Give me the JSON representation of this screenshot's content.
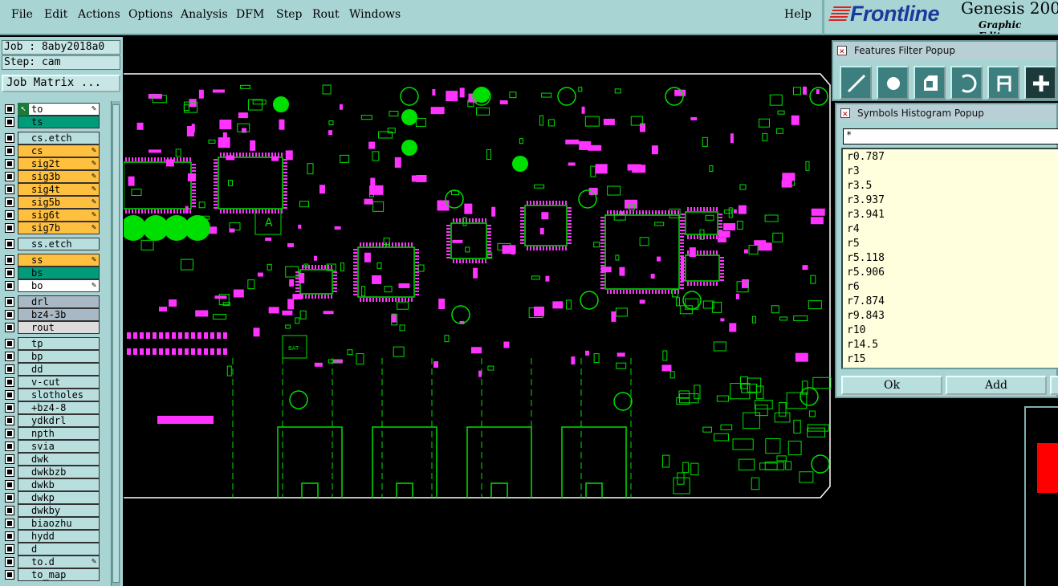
{
  "menu": [
    "File",
    "Edit",
    "Actions",
    "Options",
    "Analysis",
    "DFM",
    "Step",
    "Rout",
    "Windows"
  ],
  "help_label": "Help",
  "brand": {
    "logo": "Frontline",
    "name": "Genesis 200",
    "subtitle": "Graphic Editor"
  },
  "job": "Job : 8aby2018a0",
  "step": "Step: cam",
  "job_matrix_label": "Job Matrix ...",
  "layers": [
    {
      "name": "to",
      "color": "#ffffff",
      "edit": true,
      "active": true
    },
    {
      "name": "ts",
      "color": "#009c7a",
      "edit": false
    },
    {
      "name": "cs.etch",
      "color": "#b8dede",
      "edit": false
    },
    {
      "name": "cs",
      "color": "#ffc040",
      "edit": true
    },
    {
      "name": "sig2t",
      "color": "#ffc040",
      "edit": true
    },
    {
      "name": "sig3b",
      "color": "#ffc040",
      "edit": true
    },
    {
      "name": "sig4t",
      "color": "#ffc040",
      "edit": true
    },
    {
      "name": "sig5b",
      "color": "#ffc040",
      "edit": true
    },
    {
      "name": "sig6t",
      "color": "#ffc040",
      "edit": true
    },
    {
      "name": "sig7b",
      "color": "#ffc040",
      "edit": true
    },
    {
      "name": "ss.etch",
      "color": "#b8dede",
      "edit": false
    },
    {
      "name": "ss",
      "color": "#ffc040",
      "edit": true
    },
    {
      "name": "bs",
      "color": "#009c7a",
      "edit": false
    },
    {
      "name": "bo",
      "color": "#ffffff",
      "edit": true
    },
    {
      "name": "drl",
      "color": "#a8b8c4",
      "edit": false
    },
    {
      "name": "bz4-3b",
      "color": "#a8b8c4",
      "edit": false
    },
    {
      "name": "rout",
      "color": "#dcdcdc",
      "edit": false
    },
    {
      "name": "tp",
      "color": "#b8dede",
      "edit": false
    },
    {
      "name": "bp",
      "color": "#b8dede",
      "edit": false
    },
    {
      "name": "dd",
      "color": "#b8dede",
      "edit": false
    },
    {
      "name": "v-cut",
      "color": "#b8dede",
      "edit": false
    },
    {
      "name": "slotholes",
      "color": "#b8dede",
      "edit": false
    },
    {
      "name": "+bz4-8",
      "color": "#b8dede",
      "edit": false
    },
    {
      "name": "ydkdrl",
      "color": "#b8dede",
      "edit": false
    },
    {
      "name": "npth",
      "color": "#b8dede",
      "edit": false
    },
    {
      "name": "svia",
      "color": "#b8dede",
      "edit": false
    },
    {
      "name": "dwk",
      "color": "#b8dede",
      "edit": false
    },
    {
      "name": "dwkbzb",
      "color": "#b8dede",
      "edit": false
    },
    {
      "name": "dwkb",
      "color": "#b8dede",
      "edit": false
    },
    {
      "name": "dwkp",
      "color": "#b8dede",
      "edit": false
    },
    {
      "name": "dwkby",
      "color": "#b8dede",
      "edit": false
    },
    {
      "name": "biaozhu",
      "color": "#b8dede",
      "edit": false
    },
    {
      "name": "hydd",
      "color": "#b8dede",
      "edit": false
    },
    {
      "name": "d",
      "color": "#b8dede",
      "edit": false
    },
    {
      "name": "to.d",
      "color": "#b8dede",
      "edit": true
    },
    {
      "name": "to_map",
      "color": "#b8dede",
      "edit": false
    }
  ],
  "features_filter": {
    "title": "Features Filter Popup",
    "tools": [
      "line-tool-icon",
      "pad-tool-icon",
      "surface-tool-icon",
      "arc-tool-icon",
      "text-tool-icon",
      "add-tool-icon"
    ]
  },
  "symbols_histogram": {
    "title": "Symbols Histogram Popup",
    "search": "*",
    "items": [
      "r0.787",
      "r3",
      "r3.5",
      "r3.937",
      "r3.941",
      "r4",
      "r5",
      "r5.118",
      "r5.906",
      "r6",
      "r7.874",
      "r9.843",
      "r10",
      "r14.5",
      "r15"
    ],
    "ok_label": "Ok",
    "add_label": "Add"
  },
  "board_labels": [
    "A",
    "BAT"
  ],
  "colors": {
    "panel": "#a9d4d4",
    "board_outline": "#ffffff",
    "copper": "#00e000",
    "pads": "#ff33ff",
    "highlight": "#ff0000"
  }
}
